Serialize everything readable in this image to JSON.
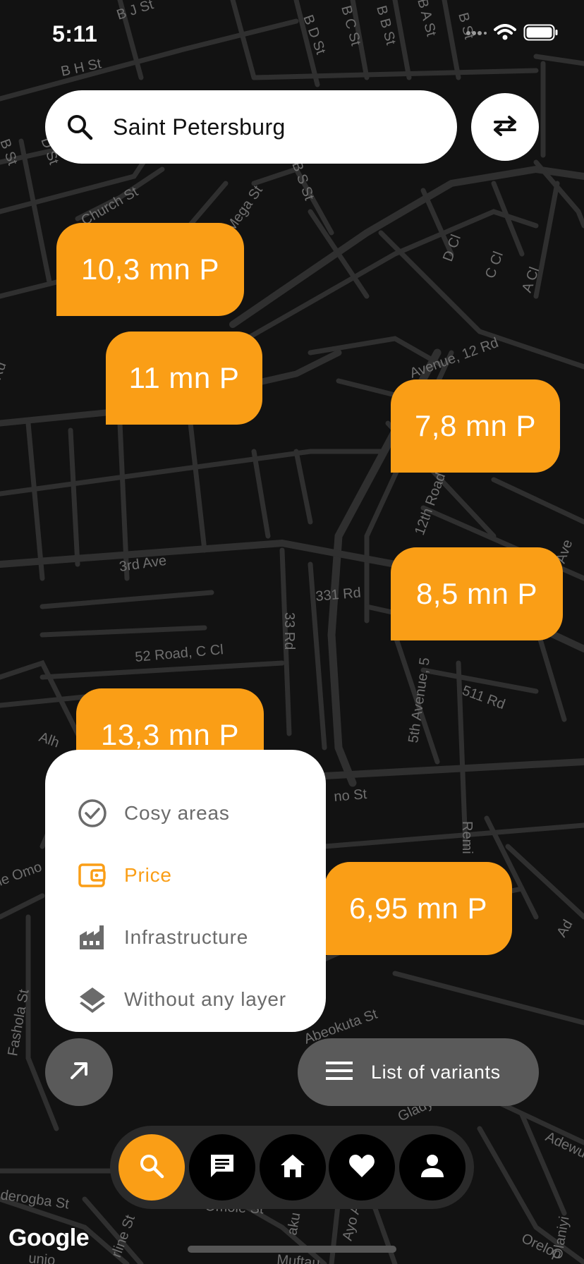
{
  "status_bar": {
    "time": "5:11"
  },
  "search": {
    "value": "Saint Petersburg",
    "icon": "search-icon"
  },
  "swap_button": {
    "icon": "swap-arrows-icon"
  },
  "price_markers": [
    {
      "label": "10,3 mn P"
    },
    {
      "label": "11 mn P"
    },
    {
      "label": "7,8 mn P"
    },
    {
      "label": "8,5 mn P"
    },
    {
      "label": "13,3 mn P"
    },
    {
      "label": "6,95 mn P"
    }
  ],
  "layer_menu": {
    "items": [
      {
        "label": "Cosy areas",
        "icon": "check-circle-icon",
        "active": false
      },
      {
        "label": "Price",
        "icon": "wallet-icon",
        "active": true
      },
      {
        "label": "Infrastructure",
        "icon": "factory-icon",
        "active": false
      },
      {
        "label": "Without any layer",
        "icon": "layers-icon",
        "active": false
      }
    ]
  },
  "actions": {
    "expand_icon": "arrow-up-right-icon",
    "variants_label": "List of variants",
    "variants_icon": "menu-icon"
  },
  "bottom_nav": {
    "items": [
      {
        "name": "search",
        "icon": "search-icon",
        "active": true
      },
      {
        "name": "chat",
        "icon": "chat-icon",
        "active": false
      },
      {
        "name": "home",
        "icon": "home-icon",
        "active": false
      },
      {
        "name": "favorites",
        "icon": "heart-icon",
        "active": false
      },
      {
        "name": "profile",
        "icon": "person-icon",
        "active": false
      }
    ]
  },
  "map": {
    "attribution": "Google",
    "street_labels": [
      "B J St",
      "B H St",
      "B D St",
      "B C St",
      "B B St",
      "B A St",
      "B St",
      "B St",
      "D St",
      "Church St",
      "Mega St",
      "B S St",
      "D Cl",
      "C Cl",
      "A Cl",
      "Rd",
      "Avenue, 12 Rd",
      "12th Road",
      "3rd Ave",
      "331 Rd",
      "33 Rd",
      "52 Road, C Cl",
      "5th Avenue, 5",
      "511 Rd",
      "Ave",
      "Alh",
      "no St",
      "Remi",
      "le Omo",
      "Fashola St",
      "Abeokuta St",
      "Gladys So",
      "Adewu",
      "Ad",
      "derogba St",
      "Omole St",
      "rline St",
      "aku S",
      "Ayo A",
      "Orelop",
      "Olaniyi",
      "Muftau",
      "unjo"
    ],
    "colors": {
      "background": "#121212",
      "road": "#2f2f2f",
      "label": "#6f6f6f"
    }
  },
  "colors": {
    "accent": "#fa9e16",
    "menu_text": "#6b6b6b",
    "pill_bg": "#5a5a5a",
    "nav_bg": "#2a2a2a"
  }
}
